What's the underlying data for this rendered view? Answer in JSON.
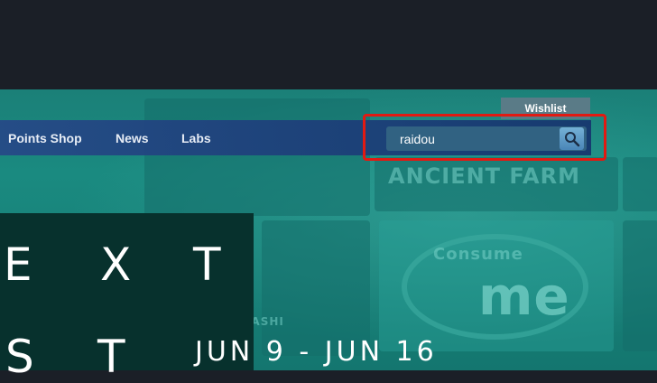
{
  "header": {
    "wishlist_label": "Wishlist"
  },
  "nav": {
    "items": [
      {
        "label": "Points Shop"
      },
      {
        "label": "News"
      },
      {
        "label": "Labs"
      }
    ]
  },
  "search": {
    "value": "raidou",
    "icon": "search-icon"
  },
  "banner": {
    "letters_row1": [
      "E",
      "X",
      "T"
    ],
    "letters_row2": [
      "S",
      "T"
    ],
    "dates": "JUN 9 - JUN 16"
  },
  "background_tiles": {
    "ancient_farm": "ANCIENT FARM",
    "consume_me": "Consume",
    "mech_rashi": "MECH RASHI",
    "me": "me"
  },
  "colors": {
    "highlight": "#e11a12",
    "nav": "#264887",
    "hero": "#1a8a80"
  }
}
